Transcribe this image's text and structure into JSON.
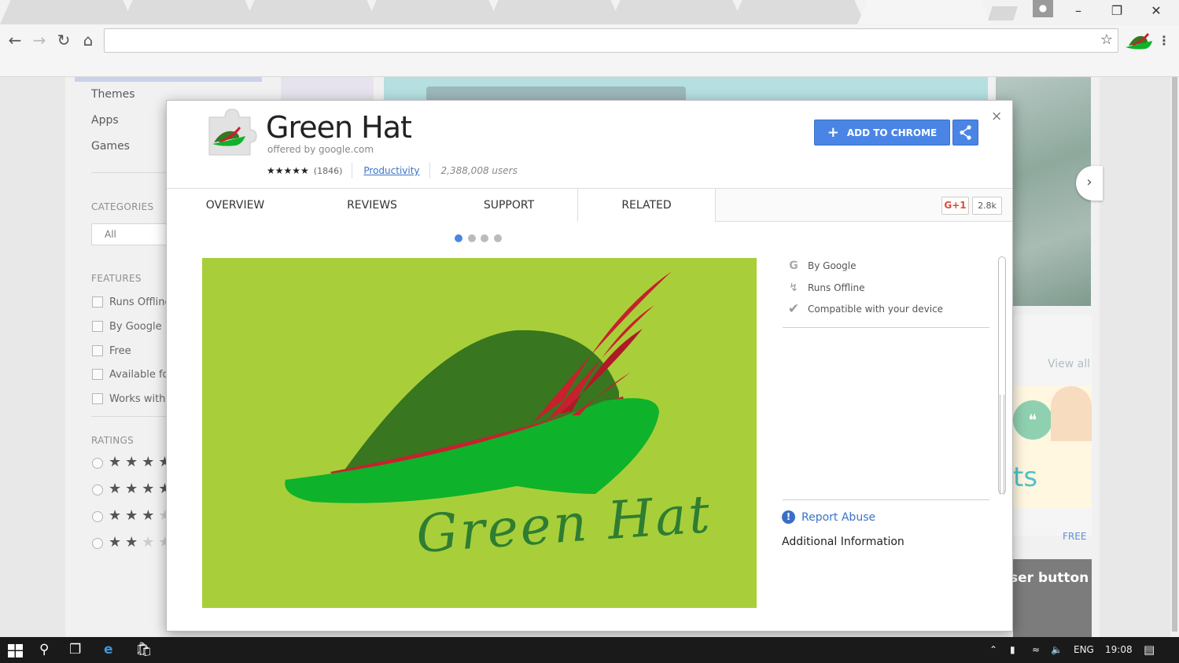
{
  "browser": {
    "tab_count": 7,
    "omnibox_value": "",
    "window_buttons": [
      "minimize",
      "restore",
      "close"
    ]
  },
  "sidebar": {
    "items": [
      {
        "label": "Themes"
      },
      {
        "label": "Apps"
      },
      {
        "label": "Games"
      }
    ],
    "categories_heading": "CATEGORIES",
    "category_select": "All",
    "features_heading": "FEATURES",
    "features": [
      {
        "label": "Runs Offline"
      },
      {
        "label": "By Google"
      },
      {
        "label": "Free"
      },
      {
        "label": "Available for Android"
      },
      {
        "label": "Works with Google Drive"
      }
    ],
    "ratings_heading": "RATINGS"
  },
  "background": {
    "view_all": "View all",
    "hangouts_text": "ts",
    "free_label": "FREE",
    "promo_text": "ser button"
  },
  "modal": {
    "title": "Green Hat",
    "offered_by": "offered by google.com",
    "rating_stars": "★★★★★",
    "rating_count": "(1846)",
    "category": "Productivity",
    "users": "2,388,008 users",
    "add_button": "ADD TO CHROME",
    "close": "×",
    "tabs": [
      {
        "label": "OVERVIEW"
      },
      {
        "label": "REVIEWS"
      },
      {
        "label": "SUPPORT"
      },
      {
        "label": "RELATED"
      }
    ],
    "gplus_label": "G+1",
    "gplus_count": "2.8k",
    "carousel_active": 0,
    "carousel_total": 4,
    "screenshot_text": "Green Hat",
    "features": [
      {
        "icon": "google-g-icon",
        "label": "By Google"
      },
      {
        "icon": "lightning-icon",
        "label": "Runs Offline"
      },
      {
        "icon": "device-check-icon",
        "label": "Compatible with your device"
      }
    ],
    "report_abuse": "Report Abuse",
    "additional_info": "Additional Information"
  },
  "taskbar": {
    "language": "ENG",
    "time": "19:08"
  },
  "colors": {
    "accent_blue": "#4a85e6",
    "hat_dark_green": "#38761f",
    "hat_bright_green": "#0fb22b",
    "feather_red": "#c8202e",
    "screenshot_bg": "#a8cf3a"
  }
}
